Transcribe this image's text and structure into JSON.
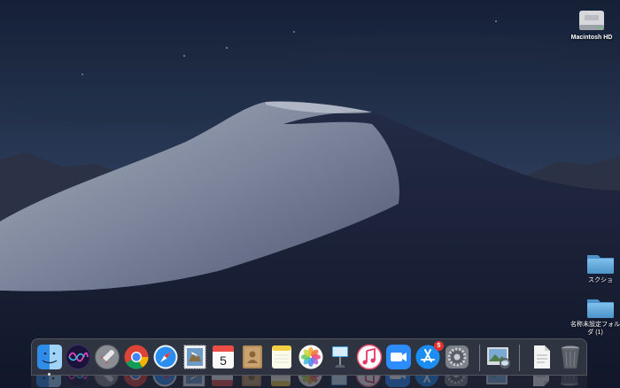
{
  "desktop": {
    "wallpaper": "macos-mojave-dark-dunes",
    "icons": [
      {
        "name": "macintosh-hd",
        "label": "Macintosh HD",
        "icon": "hard-drive-icon"
      },
      {
        "name": "folder-sukusho",
        "label": "スクショ",
        "icon": "folder-icon"
      },
      {
        "name": "folder-untitled",
        "label": "名称未設定フォルダ",
        "icon": "folder-icon",
        "suffix": "(1)"
      }
    ]
  },
  "dock": {
    "items": [
      {
        "name": "finder",
        "icon": "finder-icon",
        "running": true
      },
      {
        "name": "siri",
        "icon": "siri-icon"
      },
      {
        "name": "launchpad",
        "icon": "rocket-icon"
      },
      {
        "name": "chrome",
        "icon": "chrome-icon"
      },
      {
        "name": "safari",
        "icon": "compass-icon"
      },
      {
        "name": "mail",
        "icon": "stamp-icon"
      },
      {
        "name": "calendar",
        "icon": "calendar-icon",
        "month": "",
        "day": "5"
      },
      {
        "name": "contacts",
        "icon": "contacts-book-icon"
      },
      {
        "name": "notes",
        "icon": "notes-icon"
      },
      {
        "name": "photos",
        "icon": "photos-flower-icon"
      },
      {
        "name": "keynote",
        "icon": "keynote-podium-icon"
      },
      {
        "name": "itunes",
        "icon": "music-note-icon"
      },
      {
        "name": "zoom",
        "icon": "video-camera-icon"
      },
      {
        "name": "app-store",
        "icon": "app-store-icon",
        "badge": "5"
      },
      {
        "name": "system-preferences",
        "icon": "gear-icon"
      },
      {
        "name": "preview",
        "icon": "preview-icon"
      },
      {
        "name": "document",
        "icon": "document-icon"
      },
      {
        "name": "trash",
        "icon": "trash-icon"
      }
    ]
  },
  "colors": {
    "sky_top": "#172338",
    "sky_mid": "#2d3d5a",
    "dune_light": "#8791a6",
    "dune_dark": "#151c33",
    "folder_blue": "#5fa8d9",
    "badge_red": "#e0332e"
  }
}
